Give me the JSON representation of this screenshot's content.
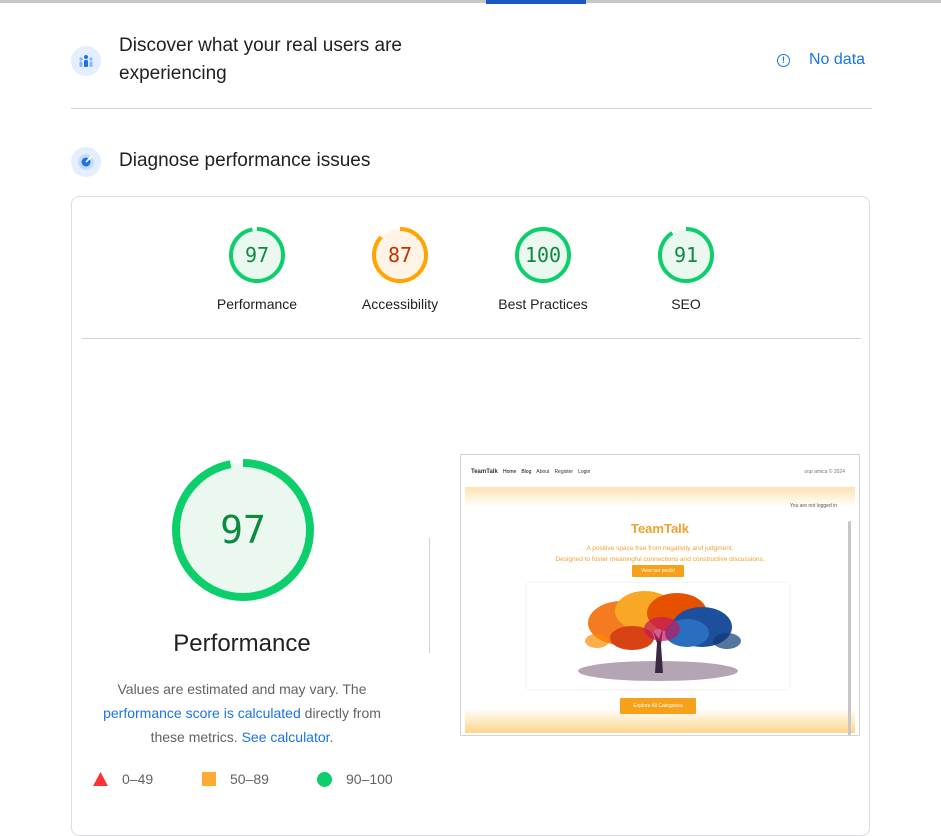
{
  "crux": {
    "title": "Discover what your real users are experiencing",
    "status": "No data",
    "info_glyph": "!"
  },
  "diagnose": {
    "title": "Diagnose performance issues"
  },
  "categories": [
    {
      "label": "Performance",
      "score": "97",
      "fraction": 0.97,
      "status": "pass"
    },
    {
      "label": "Accessibility",
      "score": "87",
      "fraction": 0.87,
      "status": "average"
    },
    {
      "label": "Best Practices",
      "score": "100",
      "fraction": 1.0,
      "status": "pass"
    },
    {
      "label": "SEO",
      "score": "91",
      "fraction": 0.91,
      "status": "pass"
    }
  ],
  "performance": {
    "score": "97",
    "fraction": 0.97,
    "title": "Performance",
    "desc_1": "Values are estimated and may vary. The",
    "link_1": "performance score is calculated",
    "desc_2": "directly from these metrics.",
    "link_2": "See calculator",
    "desc_3": "."
  },
  "legend": [
    {
      "range": "0–49",
      "shape": "triangle",
      "color": "#ff3333"
    },
    {
      "range": "50–89",
      "shape": "square",
      "color": "#ffaa33"
    },
    {
      "range": "90–100",
      "shape": "circle",
      "color": "#0cce6b"
    }
  ],
  "colors": {
    "pass": "#0cce6b",
    "pass_text": "#0c8a3f",
    "pass_bg": "#eaf8ef",
    "average": "#ffa400",
    "average_text": "#c33300",
    "average_bg": "#fff4e6",
    "link": "#1a73e8"
  },
  "screenshot": {
    "brand": "TeamTalk",
    "nav_links": [
      "Home",
      "Blog",
      "About",
      "Register",
      "Login"
    ],
    "right_text": "oop amica © 2024",
    "logged_out": "You are not logged in",
    "title": "TeamTalk",
    "subtitle_1": "A positive space free from negativity and judgment.",
    "subtitle_2": "Designed to foster meaningful connections and constructive discussions.",
    "view_button": "View our posts!",
    "explore_button": "Explore All Categories"
  }
}
